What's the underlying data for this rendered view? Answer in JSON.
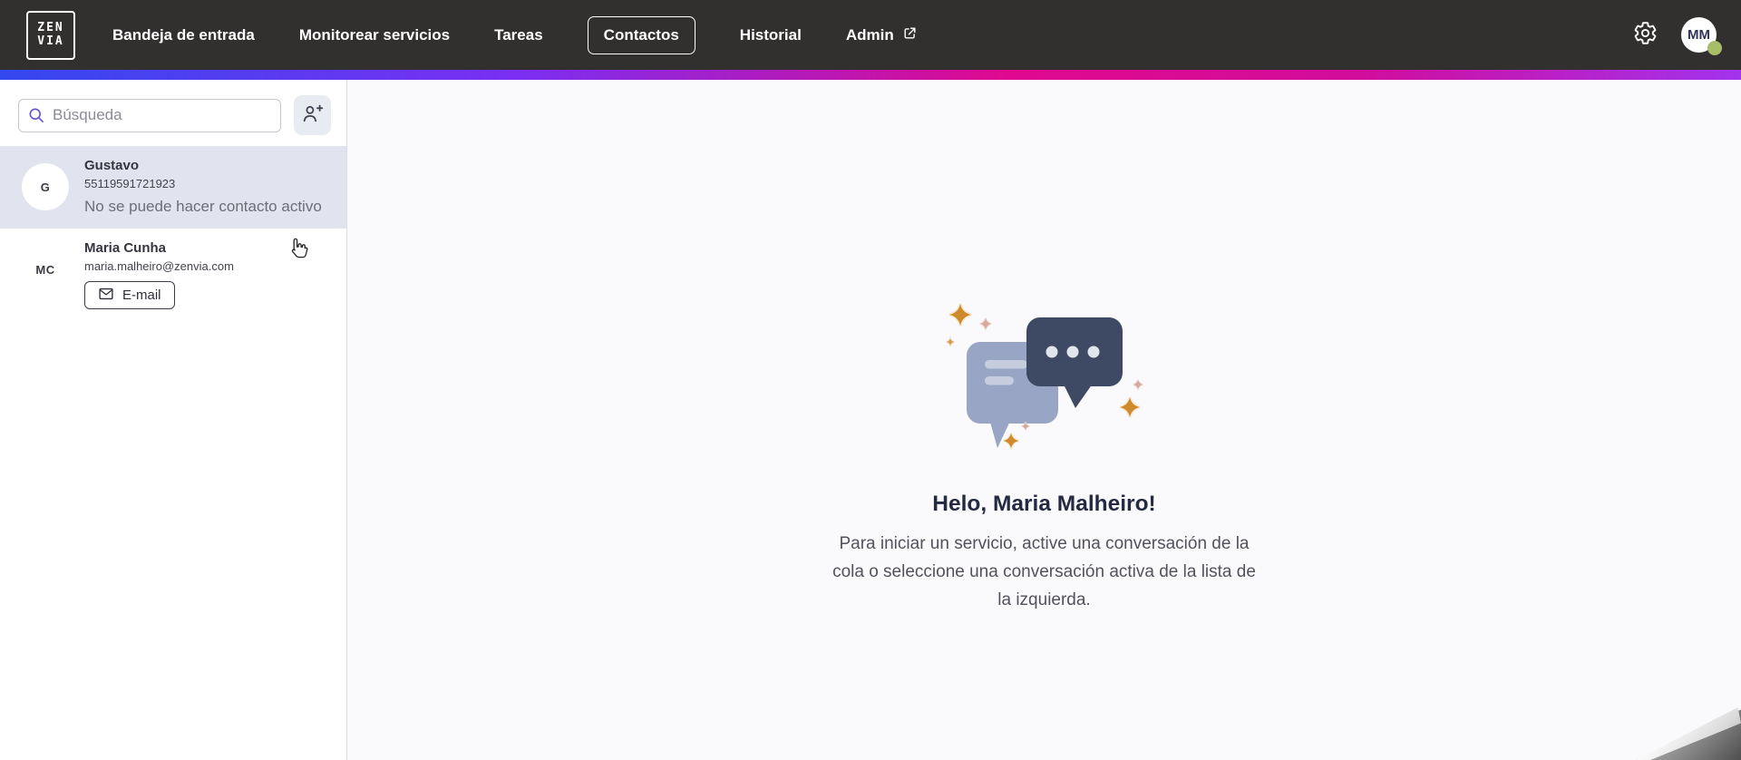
{
  "nav": {
    "logo": {
      "text_top": "ZEN",
      "text_bottom": "VIA"
    },
    "items": [
      {
        "label": "Bandeja de entrada",
        "active": false
      },
      {
        "label": "Monitorear servicios",
        "active": false
      },
      {
        "label": "Tareas",
        "active": false
      },
      {
        "label": "Contactos",
        "active": true
      },
      {
        "label": "Historial",
        "active": false
      },
      {
        "label": "Admin",
        "active": false,
        "external": true
      }
    ],
    "avatar_initials": "MM",
    "status": "online"
  },
  "sidebar": {
    "search_placeholder": "Búsqueda",
    "contacts": [
      {
        "initials": "G",
        "name": "Gustavo",
        "detail": "55119591721923",
        "status": "No se puede hacer contacto activo",
        "selected": true
      },
      {
        "initials": "MC",
        "name": "Maria Cunha",
        "detail": "maria.malheiro@zenvia.com",
        "action_label": "E-mail",
        "selected": false
      }
    ]
  },
  "main": {
    "greeting": "Helo, Maria Malheiro!",
    "instructions": "Para iniciar un servicio, active una conversación de la cola o seleccione una conversación activa de la lista de la izquierda."
  },
  "colors": {
    "nav_bg": "#322F2F",
    "gradient": [
      "#3448F0",
      "#7B2FF2",
      "#E0098E",
      "#A233EE"
    ],
    "selected_row_bg": "#E1E4EF",
    "status_dot_green": "#A9BD68",
    "bubble_dark": "#3E4A64",
    "bubble_light": "#98A5C4",
    "sparkle_orange": "#CF8A2E"
  }
}
